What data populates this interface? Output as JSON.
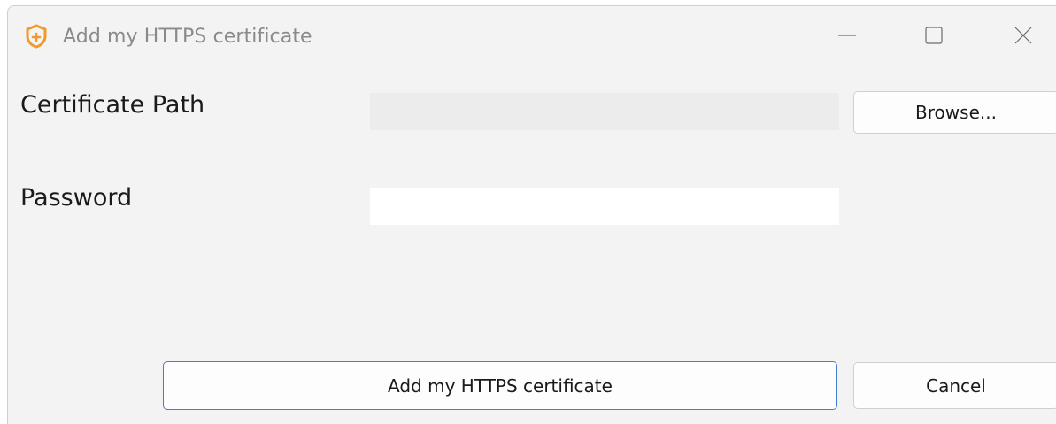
{
  "window": {
    "title": "Add my HTTPS certificate",
    "accent_color": "#f29a27",
    "focus_color": "#3f7fd0"
  },
  "form": {
    "certificate_path": {
      "label": "Certificate Path",
      "value": ""
    },
    "password": {
      "label": "Password",
      "value": ""
    },
    "browse_label": "Browse..."
  },
  "actions": {
    "submit_label": "Add my HTTPS certificate",
    "cancel_label": "Cancel"
  },
  "icons": {
    "app": "shield-plus-icon",
    "minimize": "minimize-icon",
    "maximize": "maximize-icon",
    "close": "close-icon"
  }
}
